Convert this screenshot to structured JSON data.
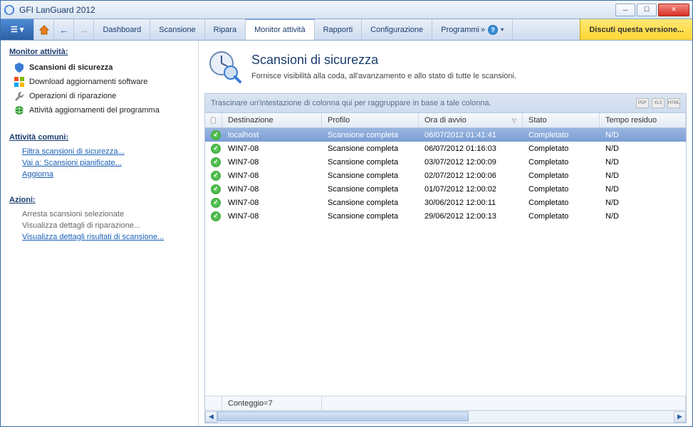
{
  "window": {
    "title": "GFI LanGuard 2012"
  },
  "toolbar": {
    "menu_label": "☰ ▾",
    "tabs": [
      {
        "label": "Dashboard"
      },
      {
        "label": "Scansione"
      },
      {
        "label": "Ripara"
      },
      {
        "label": "Monitor attività",
        "active": true
      },
      {
        "label": "Rapporti"
      },
      {
        "label": "Configurazione"
      },
      {
        "label": "Programmi",
        "chevrons": "»"
      }
    ],
    "discuss": "Discuti questa versione..."
  },
  "sidebar": {
    "monitor_heading": "Monitor attività:",
    "items": [
      {
        "label": "Scansioni di sicurezza",
        "selected": true,
        "icon": "shield"
      },
      {
        "label": "Download aggiornamenti software",
        "icon": "windows"
      },
      {
        "label": "Operazioni di riparazione",
        "icon": "wrench"
      },
      {
        "label": "Attività aggiornamenti del programma",
        "icon": "globe"
      }
    ],
    "common_heading": "Attività comuni:",
    "common_links": [
      {
        "label": "Filtra scansioni di sicurezza..."
      },
      {
        "label": "Vai a: Scansioni pianificate..."
      },
      {
        "label": "Aggiorna"
      }
    ],
    "actions_heading": "Azioni:",
    "actions": [
      {
        "label": "Arresta scansioni selezionate",
        "link": false
      },
      {
        "label": "Visualizza dettagli di riparazione...",
        "link": false
      },
      {
        "label": "Visualizza dettagli risultati di scansione...",
        "link": true
      }
    ]
  },
  "main": {
    "title": "Scansioni di sicurezza",
    "subtitle": "Fornisce visibilità alla coda, all'avanzamento e allo stato di tutte le scansioni.",
    "group_hint": "Trascinare un'intestazione di colonna qui per raggruppare in base a tale colonna.",
    "export": [
      "PDF",
      "XLS",
      "HTML"
    ],
    "columns": {
      "icon": "",
      "destination": "Destinazione",
      "profile": "Profilo",
      "start_time": "Ora di avvio",
      "status": "Stato",
      "remaining": "Tempo residuo"
    },
    "sort_indicator": "▽",
    "rows": [
      {
        "dest": "localhost",
        "prof": "Scansione completa",
        "time": "06/07/2012 01:41:41",
        "stat": "Completato",
        "rem": "N/D",
        "selected": true
      },
      {
        "dest": "WIN7-08",
        "prof": "Scansione completa",
        "time": "06/07/2012 01:16:03",
        "stat": "Completato",
        "rem": "N/D"
      },
      {
        "dest": "WIN7-08",
        "prof": "Scansione completa",
        "time": "03/07/2012 12:00:09",
        "stat": "Completato",
        "rem": "N/D"
      },
      {
        "dest": "WIN7-08",
        "prof": "Scansione completa",
        "time": "02/07/2012 12:00:06",
        "stat": "Completato",
        "rem": "N/D"
      },
      {
        "dest": "WIN7-08",
        "prof": "Scansione completa",
        "time": "01/07/2012 12:00:02",
        "stat": "Completato",
        "rem": "N/D"
      },
      {
        "dest": "WIN7-08",
        "prof": "Scansione completa",
        "time": "30/06/2012 12:00:11",
        "stat": "Completato",
        "rem": "N/D"
      },
      {
        "dest": "WIN7-08",
        "prof": "Scansione completa",
        "time": "29/06/2012 12:00:13",
        "stat": "Completato",
        "rem": "N/D"
      }
    ],
    "footer_count": "Conteggio=7"
  }
}
